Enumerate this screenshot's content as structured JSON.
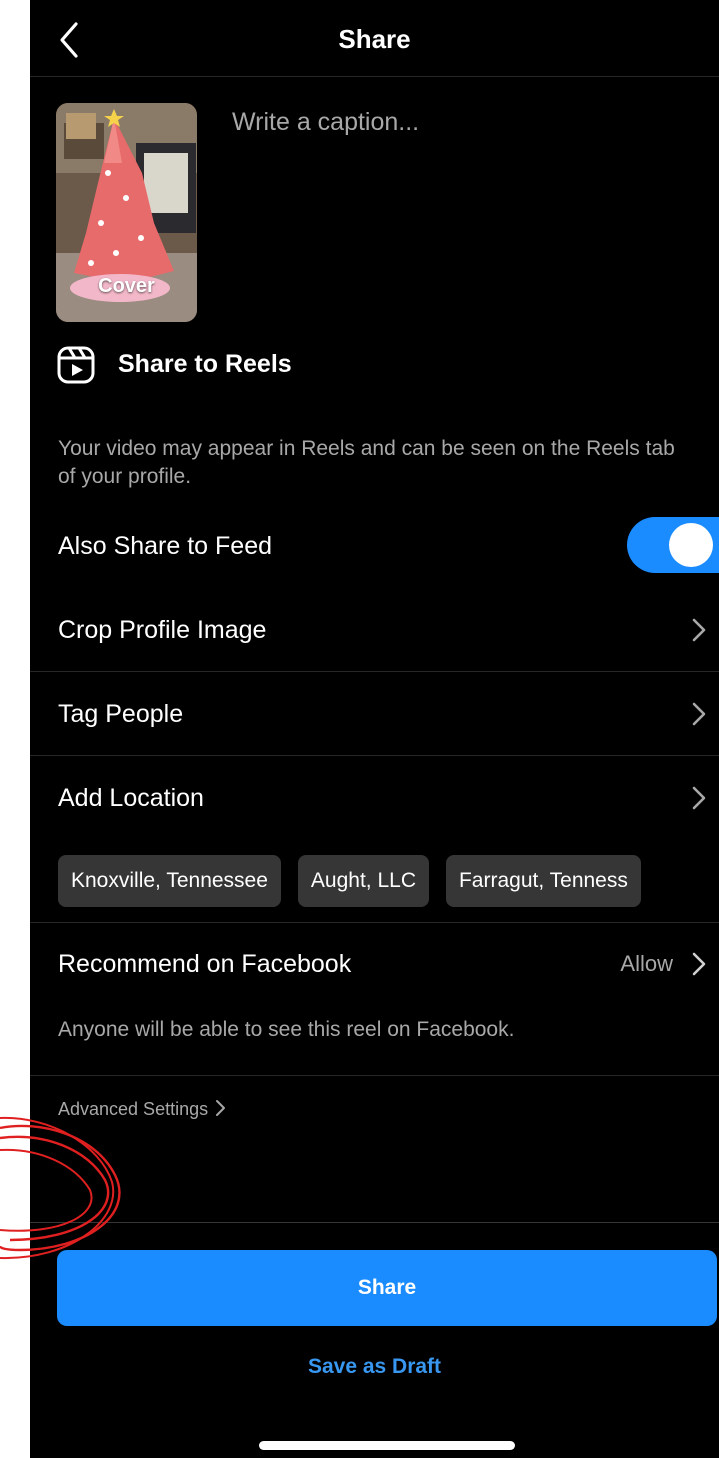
{
  "header": {
    "title": "Share",
    "back_icon": "chevron-left-icon"
  },
  "post": {
    "cover_label": "Cover",
    "caption_placeholder": "Write a caption..."
  },
  "reels": {
    "icon": "reels-icon",
    "title": "Share to Reels",
    "description": "Your video may appear in Reels and can be seen on the Reels tab of your profile."
  },
  "settings": {
    "also_share_feed": {
      "label": "Also Share to Feed",
      "enabled": true
    },
    "crop_profile": {
      "label": "Crop Profile Image"
    },
    "tag_people": {
      "label": "Tag People"
    },
    "add_location": {
      "label": "Add Location"
    },
    "location_suggestions": [
      "Knoxville, Tennessee",
      "Aught, LLC",
      "Farragut, Tenness"
    ],
    "recommend_facebook": {
      "label": "Recommend on Facebook",
      "value": "Allow"
    },
    "facebook_description": "Anyone will be able to see this reel on Facebook.",
    "advanced_settings": "Advanced Settings"
  },
  "actions": {
    "share_label": "Share",
    "save_draft_label": "Save as Draft"
  },
  "colors": {
    "accent_blue": "#1a8cff",
    "link_blue": "#3897f0",
    "background": "#000000",
    "secondary_text": "#a8a8a8",
    "annotation_red": "#e02020"
  }
}
